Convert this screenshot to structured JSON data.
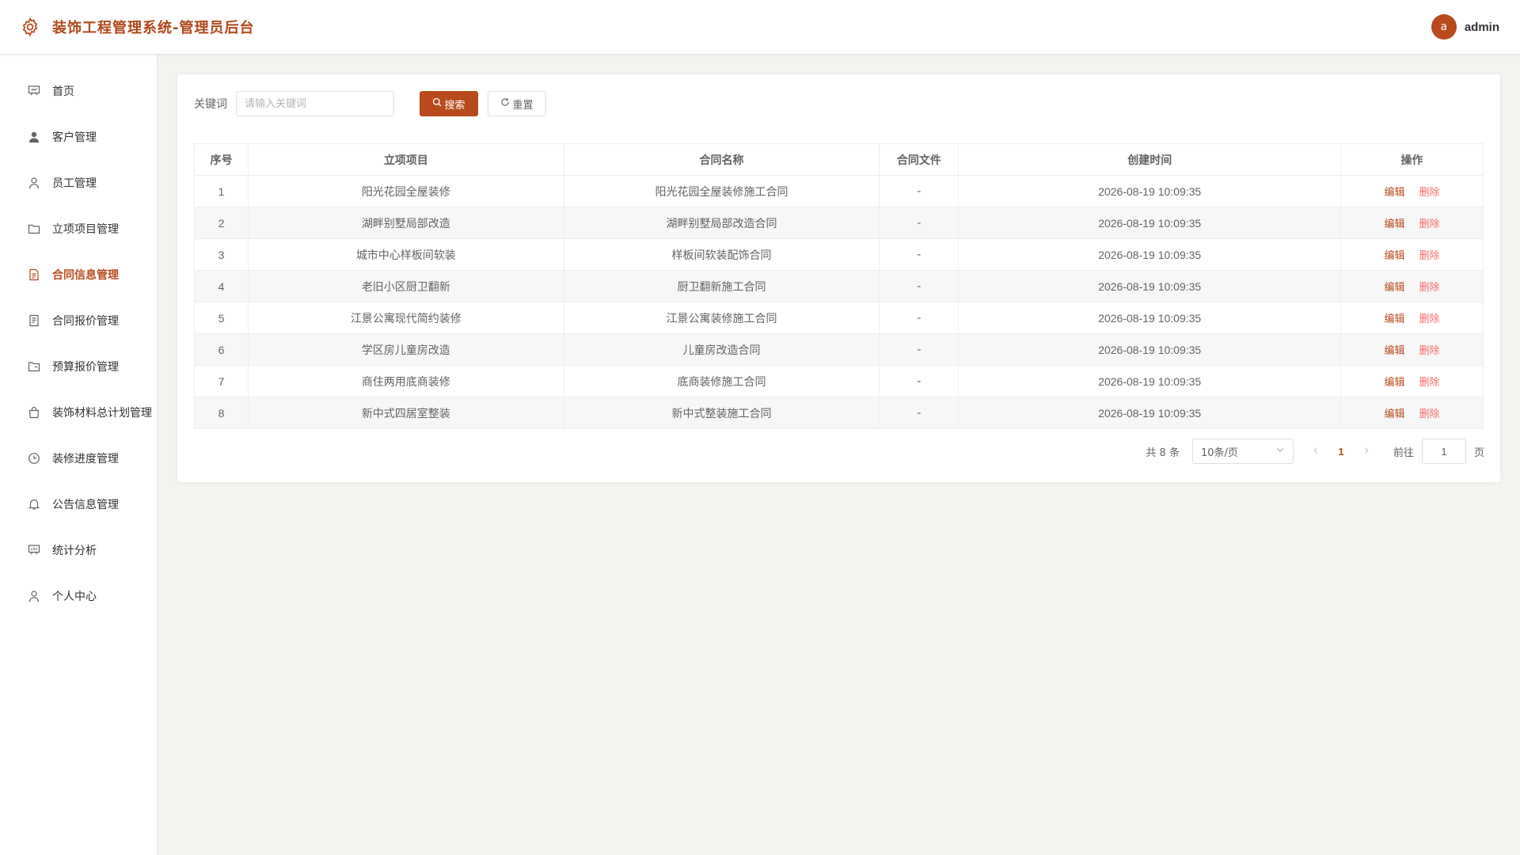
{
  "header": {
    "title": "装饰工程管理系统-管理员后台",
    "avatar_letter": "a",
    "username": "admin"
  },
  "sidebar": {
    "items": [
      {
        "label": "首页",
        "icon": "presentation-icon",
        "active": false
      },
      {
        "label": "客户管理",
        "icon": "user-filled-icon",
        "active": false
      },
      {
        "label": "员工管理",
        "icon": "user-icon",
        "active": false
      },
      {
        "label": "立项项目管理",
        "icon": "folder-icon",
        "active": false
      },
      {
        "label": "合同信息管理",
        "icon": "document-icon",
        "active": true
      },
      {
        "label": "合同报价管理",
        "icon": "tickets-icon",
        "active": false
      },
      {
        "label": "预算报价管理",
        "icon": "folder-opened-icon",
        "active": false
      },
      {
        "label": "装饰材料总计划管理",
        "icon": "shopping-bag-icon",
        "active": false
      },
      {
        "label": "装修进度管理",
        "icon": "clock-icon",
        "active": false
      },
      {
        "label": "公告信息管理",
        "icon": "bell-icon",
        "active": false
      },
      {
        "label": "统计分析",
        "icon": "data-board-icon",
        "active": false
      },
      {
        "label": "个人中心",
        "icon": "user-icon",
        "active": false
      }
    ]
  },
  "search": {
    "label": "关键词",
    "placeholder": "请输入关键词",
    "search_label": "搜索",
    "reset_label": "重置"
  },
  "table": {
    "columns": [
      "序号",
      "立项项目",
      "合同名称",
      "合同文件",
      "创建时间",
      "操作"
    ],
    "edit_label": "编辑",
    "delete_label": "删除",
    "rows": [
      {
        "no": "1",
        "project": "阳光花园全屋装修",
        "contract": "阳光花园全屋装修施工合同",
        "file": "-",
        "created": "2026-08-19 10:09:35"
      },
      {
        "no": "2",
        "project": "湖畔别墅局部改造",
        "contract": "湖畔别墅局部改造合同",
        "file": "-",
        "created": "2026-08-19 10:09:35"
      },
      {
        "no": "3",
        "project": "城市中心样板间软装",
        "contract": "样板间软装配饰合同",
        "file": "-",
        "created": "2026-08-19 10:09:35"
      },
      {
        "no": "4",
        "project": "老旧小区厨卫翻新",
        "contract": "厨卫翻新施工合同",
        "file": "-",
        "created": "2026-08-19 10:09:35"
      },
      {
        "no": "5",
        "project": "江景公寓现代简约装修",
        "contract": "江景公寓装修施工合同",
        "file": "-",
        "created": "2026-08-19 10:09:35"
      },
      {
        "no": "6",
        "project": "学区房儿童房改造",
        "contract": "儿童房改造合同",
        "file": "-",
        "created": "2026-08-19 10:09:35"
      },
      {
        "no": "7",
        "project": "商住两用底商装修",
        "contract": "底商装修施工合同",
        "file": "-",
        "created": "2026-08-19 10:09:35"
      },
      {
        "no": "8",
        "project": "新中式四居室整装",
        "contract": "新中式整装施工合同",
        "file": "-",
        "created": "2026-08-19 10:09:35"
      }
    ]
  },
  "pagination": {
    "total_text": "共 8 条",
    "page_size": "10条/页",
    "current_page": "1",
    "goto_label": "前往",
    "goto_value": "1",
    "page_suffix": "页"
  },
  "colors": {
    "accent": "#b84a1b",
    "danger": "#f56c6c"
  }
}
